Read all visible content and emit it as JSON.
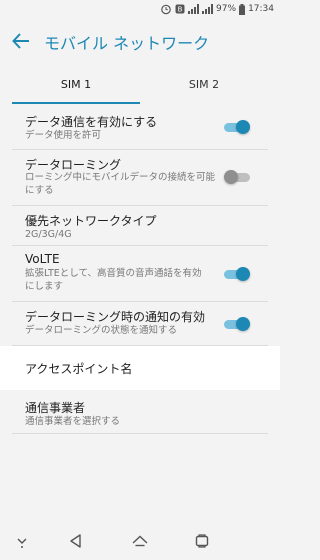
{
  "status_bar": {
    "icons": [
      "alarm-icon",
      "notification-badge-icon",
      "signal-icon",
      "signal-icon"
    ],
    "notification_badge": "B",
    "battery": "97%",
    "time": "17:34"
  },
  "header": {
    "title": "モバイル ネットワーク",
    "back_icon": "arrow-left-icon",
    "accent_color": "#1e88b5"
  },
  "tabs": [
    {
      "label": "SIM 1",
      "selected": true
    },
    {
      "label": "SIM 2",
      "selected": false
    }
  ],
  "settings": [
    {
      "title": "データ通信を有効にする",
      "subtitle": "データ使用を許可",
      "toggle": "on"
    },
    {
      "title": "データローミング",
      "subtitle": "ローミング中にモバイルデータの接続を可能にする",
      "toggle": "off"
    },
    {
      "title": "優先ネットワークタイプ",
      "subtitle": "2G/3G/4G"
    },
    {
      "title": "VoLTE",
      "subtitle": "拡張LTEとして、高音質の音声通話を有効にします",
      "toggle": "on"
    },
    {
      "title": "データローミング時の通知の有効",
      "subtitle": "データローミングの状態を通知する",
      "toggle": "on"
    },
    {
      "title": "アクセスポイント名"
    },
    {
      "title": "通信事業者",
      "subtitle": "通信事業者を選択する"
    }
  ],
  "nav_bar": {
    "icons": [
      "chevron-down-icon",
      "back-triangle-icon",
      "home-icon",
      "recents-icon"
    ]
  }
}
